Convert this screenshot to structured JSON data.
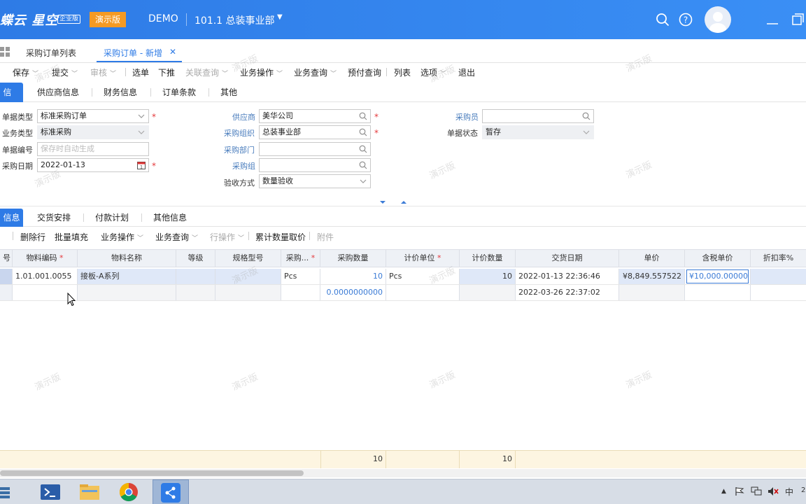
{
  "header": {
    "logo_text": "蝶云 星空",
    "edition": "企业版",
    "demo_badge": "演示版",
    "demo_name": "DEMO",
    "org": "101.1  总装事业部"
  },
  "tabs": {
    "list_tab": "采购订单列表",
    "new_tab": "采购订单 - 新增",
    "close": "✕"
  },
  "toolbar": {
    "save": "保存",
    "submit": "提交",
    "audit": "审核",
    "select_order": "选单",
    "push": "下推",
    "related_query": "关联查询",
    "biz_ops": "业务操作",
    "biz_query": "业务查询",
    "prepay_query": "预付查询",
    "list": "列表",
    "options": "选项",
    "exit": "退出"
  },
  "section_tabs": [
    "信息",
    "供应商信息",
    "财务信息",
    "订单条款",
    "其他"
  ],
  "form": {
    "bill_type_label": "单据类型",
    "bill_type_value": "标准采购订单",
    "biz_type_label": "业务类型",
    "biz_type_value": "标准采购",
    "bill_no_label": "单据编号",
    "bill_no_placeholder": "保存时自动生成",
    "date_label": "采购日期",
    "date_value": "2022-01-13",
    "supplier_label": "供应商",
    "supplier_value": "美华公司",
    "purchase_org_label": "采购组织",
    "purchase_org_value": "总装事业部",
    "purchase_dept_label": "采购部门",
    "purchase_group_label": "采购组",
    "acceptance_label": "验收方式",
    "acceptance_value": "数量验收",
    "buyer_label": "采购员",
    "status_label": "单据状态",
    "status_value": "暂存"
  },
  "lower_tabs": [
    "信息",
    "交货安排",
    "付款计划",
    "其他信息"
  ],
  "grid_toolbar": {
    "delete_row": "删除行",
    "batch_fill": "批量填充",
    "biz_ops": "业务操作",
    "biz_query": "业务查询",
    "row_ops": "行操作",
    "cumulative_price": "累计数量取价",
    "attachment": "附件"
  },
  "grid": {
    "columns": [
      "号",
      "物料编码",
      "物料名称",
      "等级",
      "规格型号",
      "采购...",
      "采购数量",
      "计价单位",
      "计价数量",
      "交货日期",
      "单价",
      "含税单价",
      "折扣率%"
    ],
    "rows": [
      [
        "",
        "1.01.001.0055",
        "接板-A系列",
        "",
        "",
        "Pcs",
        "10",
        "Pcs",
        "10",
        "2022-01-13 22:36:46",
        "¥8,849.557522",
        "¥10,000.000000",
        ""
      ],
      [
        "",
        "",
        "",
        "",
        "",
        "",
        "0.0000000000",
        "",
        "",
        "2022-03-26 22:37:02",
        "",
        "",
        ""
      ]
    ],
    "totals": {
      "qty": "10",
      "price_qty": "10"
    }
  },
  "watermark": "演示版",
  "taskbar": {
    "tray_ime": "中",
    "tray_clock": "2"
  }
}
